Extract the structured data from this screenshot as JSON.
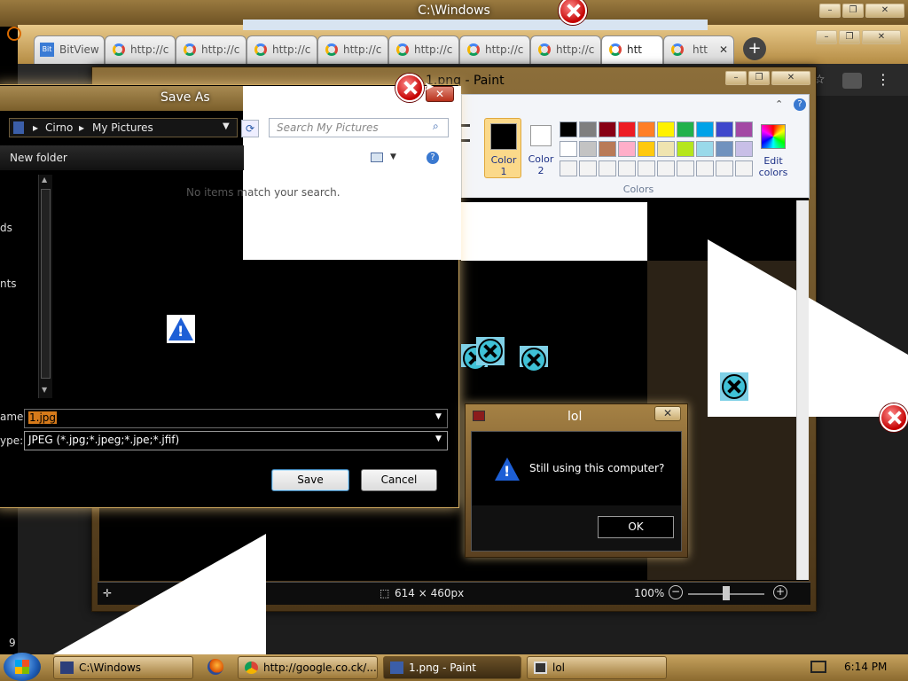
{
  "explorer": {
    "title": "C:\\Windows"
  },
  "chrome": {
    "tabs": [
      {
        "label": "BitView",
        "icon": "bitview-icon"
      },
      {
        "label": "http://c",
        "icon": "google-icon"
      },
      {
        "label": "http://c",
        "icon": "google-icon"
      },
      {
        "label": "http://c",
        "icon": "google-icon"
      },
      {
        "label": "http://c",
        "icon": "google-icon"
      },
      {
        "label": "http://c",
        "icon": "google-icon"
      },
      {
        "label": "http://c",
        "icon": "google-icon"
      },
      {
        "label": "http://c",
        "icon": "google-icon"
      },
      {
        "label": "htt",
        "icon": "google-icon"
      }
    ],
    "new_tab": "+"
  },
  "paint": {
    "title": "1.png - Paint",
    "color1_label": "Color\n1",
    "color1_a": "Color",
    "color1_b": "1",
    "color2_a": "Color",
    "color2_b": "2",
    "edit_colors_a": "Edit",
    "edit_colors_b": "colors",
    "colors_group": "Colors",
    "palette": [
      "#000000",
      "#7f7f7f",
      "#880015",
      "#ed1c24",
      "#ff7f27",
      "#fff200",
      "#22b14c",
      "#00a2e8",
      "#3f48cc",
      "#a349a4",
      "#ffffff",
      "#c3c3c3",
      "#b97a57",
      "#ffaec9",
      "#ffc90e",
      "#efe4b0",
      "#b5e61d",
      "#99d9ea",
      "#7092be",
      "#c8bfe7",
      "#f3f3f3",
      "#f3f3f3",
      "#f3f3f3",
      "#f3f3f3",
      "#f3f3f3",
      "#f3f3f3",
      "#f3f3f3",
      "#f3f3f3",
      "#f3f3f3",
      "#f3f3f3"
    ],
    "status": {
      "dimensions": "614 × 460px",
      "zoom": "100%"
    }
  },
  "save_as": {
    "title": "Save As",
    "breadcrumb": [
      "Cirno",
      "My Pictures"
    ],
    "search_placeholder": "Search My Pictures",
    "new_folder": "New folder",
    "empty_message": "No items match your search.",
    "nav_fragments": [
      "ds",
      "nts"
    ],
    "file_name_label": "ame:",
    "file_name_value": "1.jpg",
    "file_type_label": "ype:",
    "file_type_value": "JPEG (*.jpg;*.jpeg;*.jpe;*.jfif)",
    "save": "Save",
    "cancel": "Cancel"
  },
  "msgbox": {
    "title": "lol",
    "message": "Still using this computer?",
    "ok": "OK"
  },
  "taskbar": {
    "items": [
      {
        "label": "C:\\Windows",
        "icon": "folder-icon"
      },
      {
        "label": "",
        "icon": "firefox-icon"
      },
      {
        "label": "http://google.co.ck/...",
        "icon": "chrome-icon"
      },
      {
        "label": "1.png - Paint",
        "icon": "paint-icon"
      },
      {
        "label": "lol",
        "icon": "window-icon"
      }
    ],
    "clock": "6:14 PM",
    "stray_digit": "9"
  }
}
